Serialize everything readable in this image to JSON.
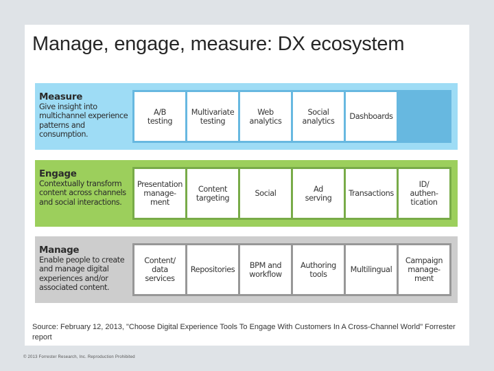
{
  "slide": {
    "title": "Manage, engage, measure: DX ecosystem",
    "source": "Source: February 12, 2013, \"Choose Digital Experience Tools To Engage With Customers In A Cross-Channel World\" Forrester report",
    "copyright": "© 2013 Forrester Research, Inc. Reproduction Prohibited"
  },
  "colors": {
    "measure_band": "#9edcf5",
    "measure_strip": "#67b8e0",
    "engage_band": "#9ccf5c",
    "engage_strip": "#78ab48",
    "manage_band": "#cdcdcd",
    "manage_strip": "#979797"
  },
  "bands": {
    "measure": {
      "heading": "Measure",
      "description": "Give insight into multichannel experience patterns and consumption.",
      "cells": [
        "A/B\ntesting",
        "Multivariate\ntesting",
        "Web\nanalytics",
        "Social\nanalytics",
        "Dashboards"
      ]
    },
    "engage": {
      "heading": "Engage",
      "description": "Contextually transform content across channels and social interactions.",
      "cells": [
        "Presentation\nmanage-\nment",
        "Content\ntargeting",
        "Social",
        "Ad\nserving",
        "Transactions",
        "ID/\nauthen-\ntication"
      ]
    },
    "manage": {
      "heading": "Manage",
      "description": "Enable people to create and manage digital experiences and/or associated content.",
      "cells": [
        "Content/\ndata\nservices",
        "Repositories",
        "BPM and\nworkflow",
        "Authoring\ntools",
        "Multilingual",
        "Campaign\nmanage-\nment"
      ]
    }
  }
}
